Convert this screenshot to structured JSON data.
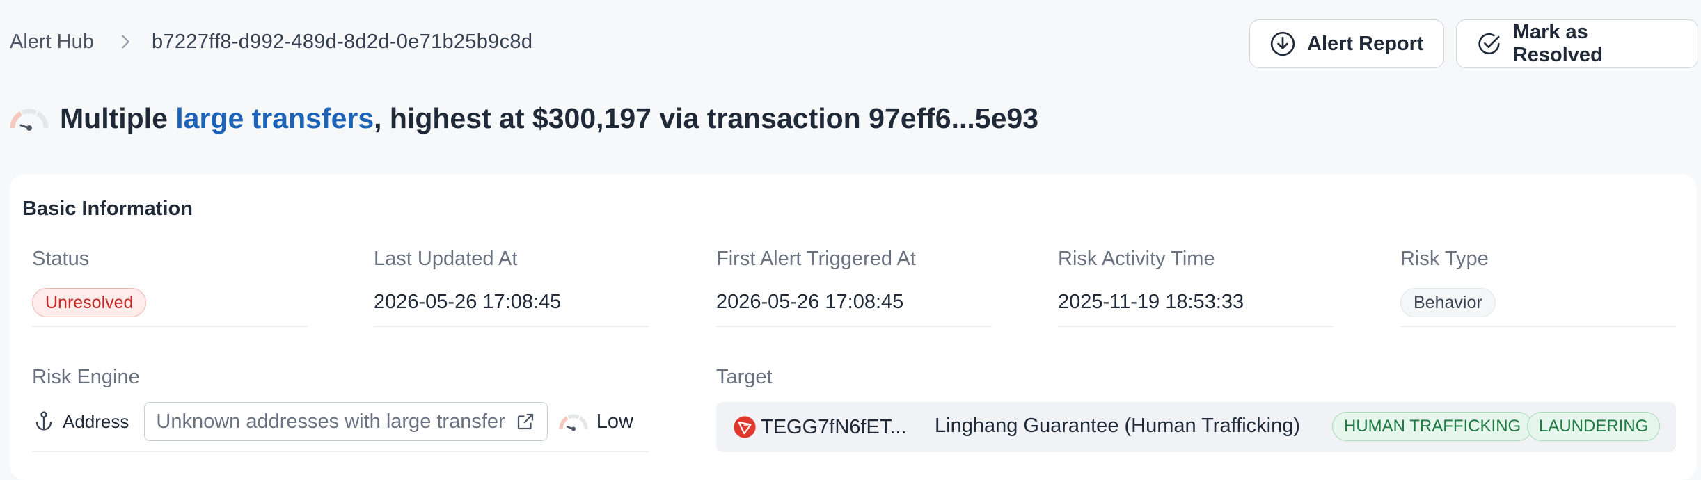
{
  "breadcrumb": {
    "root": "Alert Hub",
    "current": "b7227ff8-d992-489d-8d2d-0e71b25b9c8d"
  },
  "actions": {
    "report_label": "Alert Report",
    "resolve_label": "Mark as Resolved"
  },
  "headline": {
    "prefix": "Multiple ",
    "link_text": "large transfers",
    "suffix": ", highest at $300,197 via transaction 97eff6...5e93"
  },
  "basic_info": {
    "title": "Basic Information",
    "status": {
      "label": "Status",
      "value": "Unresolved"
    },
    "last_updated": {
      "label": "Last Updated At",
      "value": "2026-05-26 17:08:45"
    },
    "first_alert": {
      "label": "First Alert Triggered At",
      "value": "2026-05-26 17:08:45"
    },
    "risk_activity": {
      "label": "Risk Activity Time",
      "value": "2025-11-19 18:53:33"
    },
    "risk_type": {
      "label": "Risk Type",
      "value": "Behavior"
    },
    "risk_engine": {
      "label": "Risk Engine",
      "type": "Address",
      "rule": "Unknown addresses with large transfer",
      "level": "Low"
    },
    "target": {
      "label": "Target",
      "address": "TEGG7fN6fET...",
      "name": "Linghang Guarantee (Human Trafficking)",
      "tags": [
        "HUMAN TRAFFICKING",
        "LAUNDERING"
      ]
    }
  },
  "colors": {
    "accent_link": "#1d64b8",
    "status_red": "#c62828",
    "tag_green": "#1f7a43",
    "tron_red": "#e0382f"
  }
}
